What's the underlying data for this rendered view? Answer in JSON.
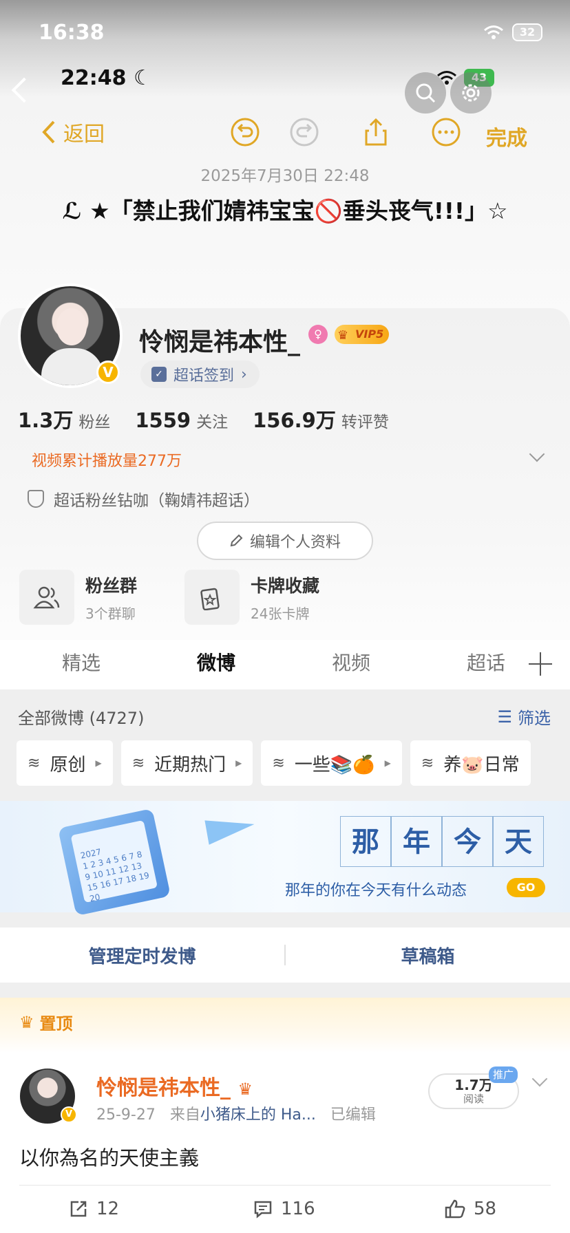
{
  "status_bar_outer": {
    "time": "16:38",
    "battery": "32"
  },
  "status_bar_inner": {
    "time": "22:48",
    "battery": "43"
  },
  "note_header": {
    "back_label": "返回",
    "done_label": "完成",
    "date": "2025年7月30日 22:48",
    "title": "ℒ ★「禁止我们婧祎宝宝🚫垂头丧气!!!」☆"
  },
  "profile": {
    "username": "怜悯是祎本性_",
    "vip_label": "VIP5",
    "verified_badge": "V",
    "super_topic_signin": "超话签到",
    "stats": [
      {
        "value": "1.3万",
        "label": "粉丝"
      },
      {
        "value": "1559",
        "label": "关注"
      },
      {
        "value": "156.9万",
        "label": "转评赞"
      }
    ],
    "video_plays": "视频累计播放量277万",
    "fan_level": "超话粉丝钻咖（鞠婧祎超话）",
    "edit_profile": "编辑个人资料",
    "tiles": [
      {
        "title": "粉丝群",
        "sub": "3个群聊",
        "icon": "group-icon"
      },
      {
        "title": "卡牌收藏",
        "sub": "24张卡牌",
        "icon": "card-icon"
      }
    ]
  },
  "tabs": [
    "精选",
    "微博",
    "视频",
    "超话"
  ],
  "active_tab": "微博",
  "feed": {
    "all_count": "全部微博 (4727)",
    "filter_label": "筛选",
    "chips": [
      "原创",
      "近期热门",
      "一些📚🍊",
      "养🐷日常"
    ]
  },
  "banner": {
    "chars": [
      "那",
      "年",
      "今",
      "天"
    ],
    "subtitle": "那年的你在今天有什么动态",
    "go_label": "GO",
    "calendar_year": "2027",
    "calendar_digits": "1 2 3 4 5 6 7 8 9 10 11 12 13 15 16 17 18 19 20"
  },
  "manage": {
    "scheduled": "管理定时发博",
    "drafts": "草稿箱"
  },
  "pinned_post": {
    "pin_label": "置顶",
    "author": "怜悯是祎本性_",
    "date": "25-9-27",
    "source_prefix": "来自",
    "source": "小猪床上的 Ha...",
    "edited": "已编辑",
    "reads_value": "1.7万",
    "reads_label": "阅读",
    "ad_label": "推广",
    "text": "以你為名的天使主義",
    "reposts": "12",
    "comments": "116",
    "likes": "58"
  },
  "colors": {
    "accent_orange": "#ea6a23",
    "note_yellow": "#e0a726",
    "link_blue": "#3e5a8a",
    "vip_gold": "#f7b500"
  }
}
